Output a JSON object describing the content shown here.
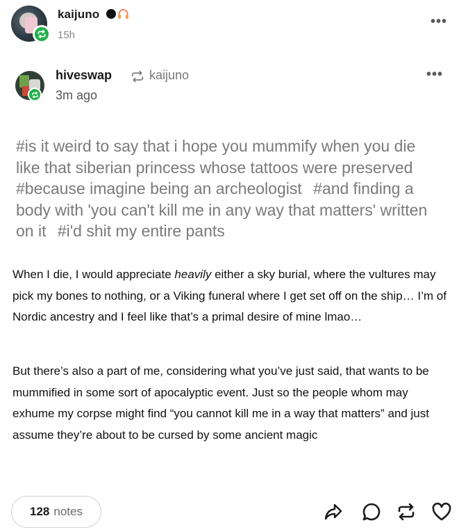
{
  "post": {
    "reblogger": {
      "username": "kaijuno",
      "time": "15h",
      "icons": [
        "black-circle-icon",
        "headphones-icon"
      ]
    },
    "original": {
      "username": "hiveswap",
      "reblogged_from": "kaijuno",
      "time": "3m ago"
    },
    "tags": [
      "#is it weird to say that i hope you mummify when you die like that siberian princess whose tattoos were preserved",
      "#because imagine being an archeologist",
      "#and finding a body with 'you can't kill me in any way that matters' written on it",
      "#i'd shit my entire pants"
    ],
    "body": {
      "p1_before": "When I die, I would appreciate ",
      "p1_emph": "heavily",
      "p1_after": " either a sky burial, where the vultures may pick my bones to nothing, or a Viking funeral where I get set off on the ship… I’m of Nordic ancestry and I feel like that’s a primal desire of mine lmao…",
      "p2": "But there’s also a part of me, considering what you’ve just said, that wants to be mummified in some sort of apocalyptic event. Just so the people whom may exhume my corpse might find “you cannot kill me in a way that matters” and just assume they’re about to be cursed by some ancient magic"
    },
    "footer": {
      "notes_count": "128",
      "notes_label": "notes",
      "actions": [
        "share-icon",
        "reply-icon",
        "reblog-icon",
        "like-icon"
      ]
    },
    "colors": {
      "reblog_green": "#21b04b",
      "tag_gray": "#7a7a7a"
    }
  }
}
